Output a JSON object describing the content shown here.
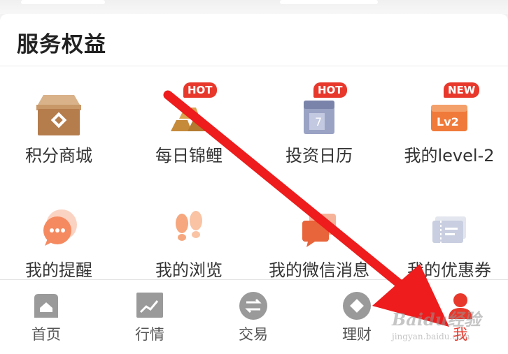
{
  "section": {
    "title": "服务权益"
  },
  "grid": [
    {
      "label": "积分商城",
      "icon": "gift-box-icon"
    },
    {
      "label": "每日锦鲤",
      "icon": "gold-bars-icon",
      "badge": "HOT"
    },
    {
      "label": "投资日历",
      "icon": "calendar-icon",
      "badge": "HOT",
      "calendar_day": "7"
    },
    {
      "label": "我的level-2",
      "icon": "level2-icon",
      "badge": "NEW",
      "icon_text": "Lv2"
    },
    {
      "label": "我的提醒",
      "icon": "reminder-bubble-icon"
    },
    {
      "label": "我的浏览",
      "icon": "footprints-icon"
    },
    {
      "label": "我的微信消息",
      "icon": "wechat-message-icon"
    },
    {
      "label": "我的优惠券",
      "icon": "coupon-icon"
    }
  ],
  "tabbar": [
    {
      "label": "首页",
      "icon": "home-icon",
      "active": false
    },
    {
      "label": "行情",
      "icon": "market-chart-icon",
      "active": false
    },
    {
      "label": "交易",
      "icon": "trade-exchange-icon",
      "active": false
    },
    {
      "label": "理财",
      "icon": "wealth-icon",
      "active": false
    },
    {
      "label": "我",
      "icon": "profile-icon",
      "active": true
    }
  ],
  "colors": {
    "accent": "#e8382c",
    "arrow": "#ee1c1c",
    "tab_inactive": "#9a9a9a"
  },
  "watermark": {
    "brand": "Baidu经验",
    "url": "jingyan.baidu.com"
  }
}
